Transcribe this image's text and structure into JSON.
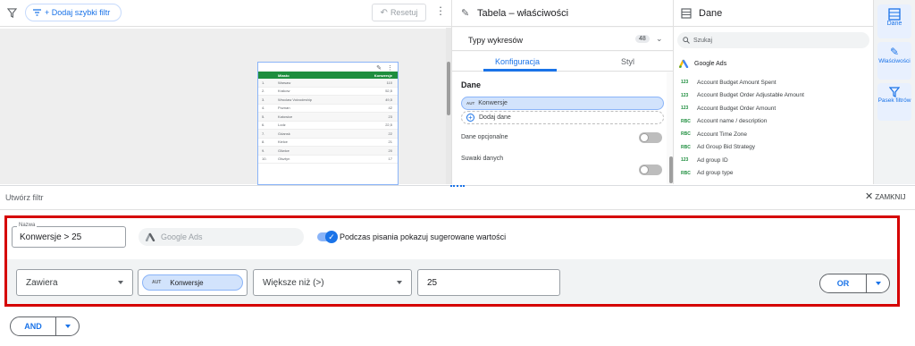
{
  "toolbar": {
    "quick_filter_label": "+ Dodaj szybki filtr",
    "reset_label": "Resetuj"
  },
  "report_table": {
    "headers": [
      "Miasto",
      "Konwersje"
    ],
    "rows": [
      {
        "n": "1.",
        "city": "Warsaw",
        "value": "110"
      },
      {
        "n": "2.",
        "city": "Krakow",
        "value": "52,5"
      },
      {
        "n": "3.",
        "city": "Wroclaw Voivodeship",
        "value": "49,5"
      },
      {
        "n": "4.",
        "city": "Poznan",
        "value": "42"
      },
      {
        "n": "5.",
        "city": "Katowice",
        "value": "23"
      },
      {
        "n": "6.",
        "city": "Lodz",
        "value": "22,5"
      },
      {
        "n": "7.",
        "city": "Gdansk",
        "value": "22"
      },
      {
        "n": "8.",
        "city": "Kielce",
        "value": "21"
      },
      {
        "n": "9.",
        "city": "Gliwice",
        "value": "20"
      },
      {
        "n": "10.",
        "city": "Olsztyn",
        "value": "17"
      }
    ]
  },
  "properties": {
    "title": "Tabela – właściwości",
    "chart_types_label": "Typy wykresów",
    "chart_types_count": "48",
    "tab_config": "Konfiguracja",
    "tab_style": "Styl",
    "data_section": "Dane",
    "metric_type": "AUT",
    "metric_name": "Konwersje",
    "add_data": "Dodaj dane",
    "optional_data": "Dane opcjonalne",
    "data_sliders": "Suwaki danych"
  },
  "data_panel": {
    "title": "Dane",
    "search_placeholder": "Szukaj",
    "source": "Google Ads",
    "fields": [
      {
        "type": "123",
        "name": "Account Budget Amount Spent"
      },
      {
        "type": "123",
        "name": "Account Budget Order Adjustable Amount"
      },
      {
        "type": "123",
        "name": "Account Budget Order Amount"
      },
      {
        "type": "RBC",
        "name": "Account name / description"
      },
      {
        "type": "RBC",
        "name": "Account Time Zone"
      },
      {
        "type": "RBC",
        "name": "Ad Group Bid Strategy"
      },
      {
        "type": "123",
        "name": "Ad group ID"
      },
      {
        "type": "RBC",
        "name": "Ad group type"
      }
    ]
  },
  "rail": {
    "data": "Dane",
    "properties": "Właściwości",
    "filter_bar": "Pasek filtrów"
  },
  "filter_builder": {
    "title": "Utwórz filtr",
    "close_label": "ZAMKNIJ",
    "name_label": "Nazwa",
    "name_value": "Konwersje > 25",
    "source": "Google Ads",
    "suggest_label": "Podczas pisania pokazuj sugerowane wartości",
    "condition_mode": "Zawiera",
    "field_type": "AUT",
    "field_name": "Konwersje",
    "operator": "Większe niż (>)",
    "value": "25",
    "or_label": "OR",
    "and_label": "AND"
  },
  "colors": {
    "accent": "#1a73e8",
    "highlight_border": "#d50000",
    "table_header": "#1e8e3e"
  }
}
